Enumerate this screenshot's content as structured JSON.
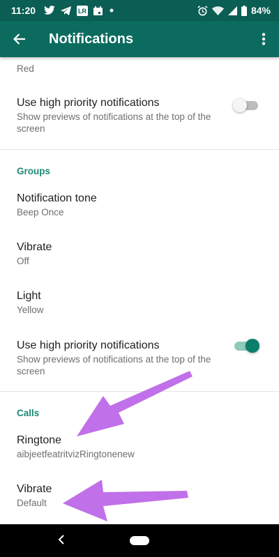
{
  "status_bar": {
    "time": "11:20",
    "battery": "84%",
    "left_icons": [
      "twitter-icon",
      "telegram-icon",
      "lightroom-icon",
      "calendar-icon",
      "dot-icon"
    ],
    "right_icons": [
      "alarm-icon",
      "wifi-icon",
      "signal-icon",
      "battery-icon"
    ]
  },
  "app_bar": {
    "title": "Notifications",
    "back_icon": "arrow-left-icon",
    "menu_icon": "more-vert-icon",
    "color": "#0b6b5f"
  },
  "top_partial": {
    "subtitle": "Red"
  },
  "messages_section": {
    "high_priority": {
      "title": "Use high priority notifications",
      "subtitle": "Show previews of notifications at the top of the screen",
      "enabled": false
    }
  },
  "groups_section": {
    "header": "Groups",
    "notification_tone": {
      "title": "Notification tone",
      "subtitle": "Beep Once"
    },
    "vibrate": {
      "title": "Vibrate",
      "subtitle": "Off"
    },
    "light": {
      "title": "Light",
      "subtitle": "Yellow"
    },
    "high_priority": {
      "title": "Use high priority notifications",
      "subtitle": "Show previews of notifications at the top of the screen",
      "enabled": true
    }
  },
  "calls_section": {
    "header": "Calls",
    "ringtone": {
      "title": "Ringtone",
      "subtitle": "aibjeetfeatritvizRingtonenew"
    },
    "vibrate": {
      "title": "Vibrate",
      "subtitle": "Default"
    }
  },
  "colors": {
    "accent": "#1f8a76",
    "switch_on": "#0b7e6c",
    "arrow": "#c070e8"
  }
}
